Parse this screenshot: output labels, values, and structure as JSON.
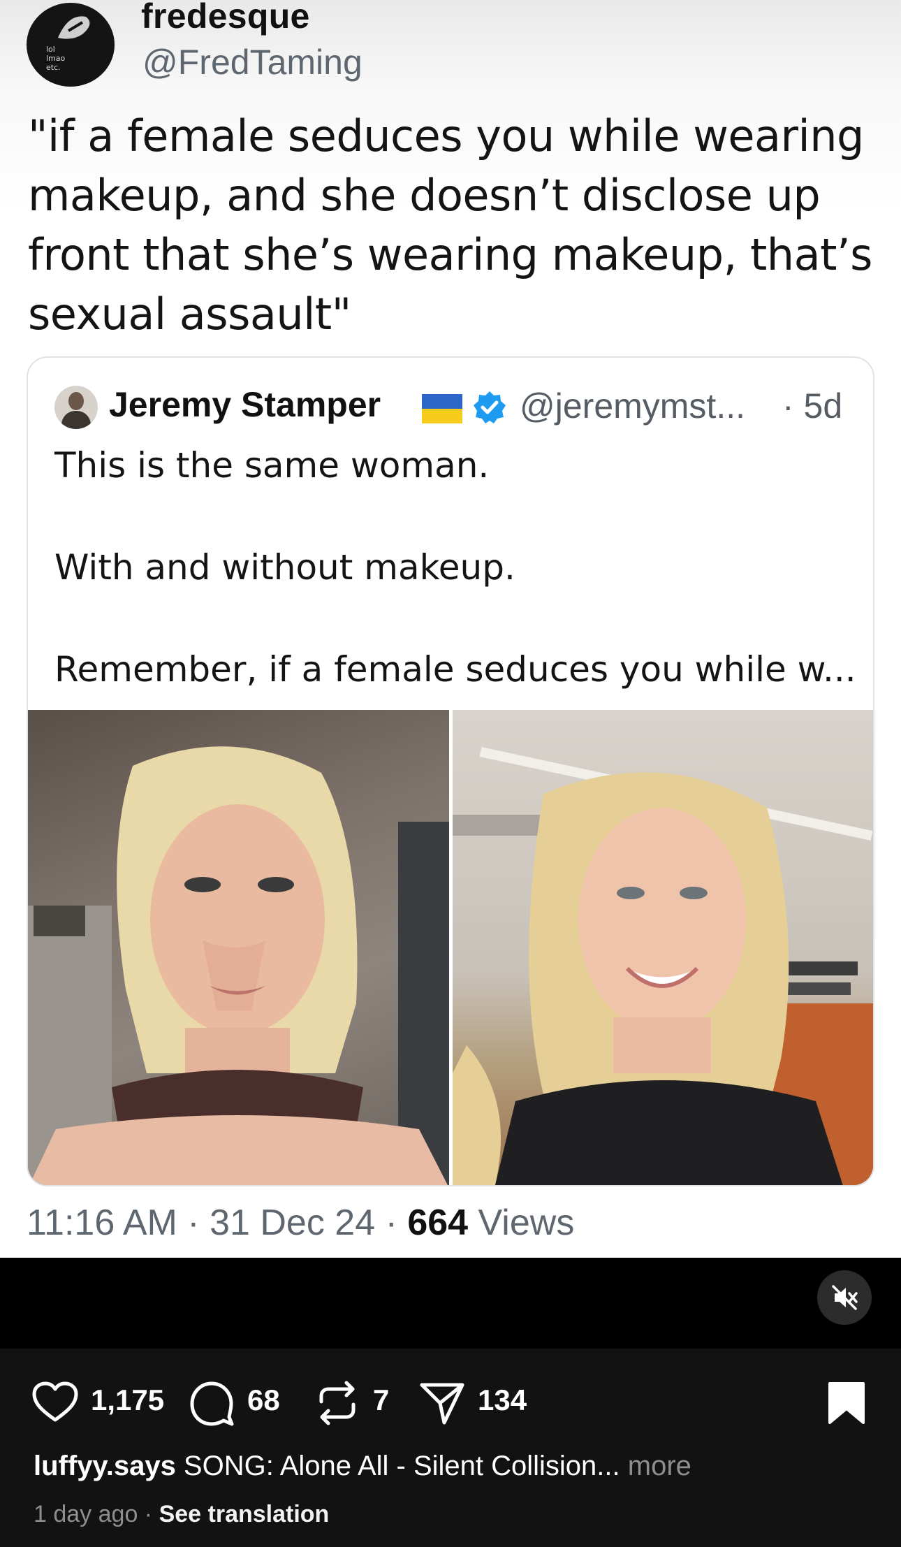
{
  "tweet": {
    "display_name": "fredesque",
    "handle": "@FredTaming",
    "avatar_text": [
      "lol",
      "lmao",
      "etc."
    ],
    "text_lines": [
      "\"if a female seduces you while wearing",
      "makeup, and she doesn’t disclose up",
      "front that she’s wearing makeup, that’s",
      "sexual assault\""
    ],
    "quote": {
      "name": "Jeremy Stamper",
      "handle": "@jeremymst...",
      "time": "· 5d",
      "lines": [
        "This is the same woman.",
        "",
        "With and without makeup.",
        "",
        "Remember, if a female seduces you while w..."
      ]
    },
    "meta": {
      "time": "11:16 AM",
      "sep1": " · ",
      "date": "31 Dec 24",
      "sep2": " · ",
      "views_count": "664",
      "views_label": " Views"
    }
  },
  "post": {
    "likes": "1,175",
    "comments": "68",
    "reposts": "7",
    "shares": "134",
    "caption_user": "luffyy.says",
    "caption_text": " SONG: Alone All - Silent Collision...",
    "caption_more": " more",
    "time_ago": "1 day ago",
    "dot": " · ",
    "see_translation": "See translation"
  },
  "colors": {
    "verified": "#1d9bf0",
    "flag_blue": "#2c66c9",
    "flag_yellow": "#f6cd1a",
    "bar_bg": "#121212"
  },
  "icons": [
    "heart-icon",
    "comment-icon",
    "repost-icon",
    "share-icon",
    "bookmark-icon",
    "mute-icon",
    "verified-icon"
  ]
}
